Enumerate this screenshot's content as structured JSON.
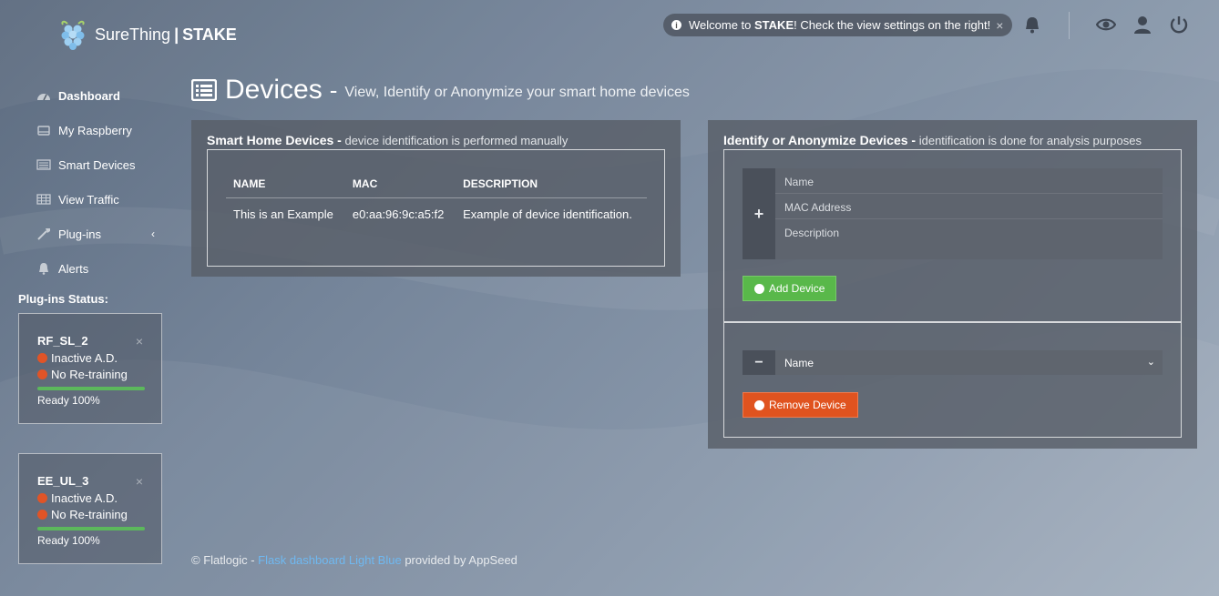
{
  "brand": {
    "name": "SureThing",
    "separator": "|",
    "product": "STAKE"
  },
  "welcome": {
    "prefix": "Welcome to ",
    "bold": "STAKE",
    "suffix": "! Check the view settings on the right!",
    "close": "×"
  },
  "header_icons": [
    "bell-icon",
    "eye-icon",
    "user-icon",
    "power-icon"
  ],
  "sidebar": {
    "items": [
      {
        "label": "Dashboard",
        "icon": "dashboard-icon",
        "active": true
      },
      {
        "label": "My Raspberry",
        "icon": "raspberry-icon"
      },
      {
        "label": "Smart Devices",
        "icon": "devices-list-icon"
      },
      {
        "label": "View Traffic",
        "icon": "table-icon"
      },
      {
        "label": "Plug-ins",
        "icon": "plugin-icon",
        "chevron": "‹"
      },
      {
        "label": "Alerts",
        "icon": "bell-icon"
      }
    ],
    "plugins_title": "Plug-ins Status:",
    "plugins": [
      {
        "name": "RF_SL_2",
        "status1": "Inactive A.D.",
        "status2": "No Re-training",
        "progress": 1.0,
        "ready": "Ready 100%"
      },
      {
        "name": "EE_UL_3",
        "status1": "Inactive A.D.",
        "status2": "No Re-training",
        "progress": 1.0,
        "ready": "Ready 100%"
      }
    ],
    "close": "×"
  },
  "page": {
    "title": "Devices",
    "dash": "-",
    "subtitle": "View, Identify or Anonymize your smart home devices"
  },
  "devices_panel": {
    "title": "Smart Home Devices -",
    "desc": "device identification is performed manually",
    "columns": [
      "NAME",
      "MAC",
      "DESCRIPTION"
    ],
    "rows": [
      [
        "This is an Example",
        "e0:aa:96:9c:a5:f2",
        "Example of device identification."
      ]
    ]
  },
  "identify_panel": {
    "title": "Identify or Anonymize Devices -",
    "desc": "identification is done for analysis purposes",
    "name_placeholder": "Name",
    "mac_placeholder": "MAC Address",
    "description_placeholder": "Description",
    "add_label": "Add Device",
    "select_value": "Name",
    "remove_label": "Remove Device",
    "plus": "+",
    "minus": "−"
  },
  "footer": {
    "prefix": "© Flatlogic - ",
    "link": "Flask dashboard Light Blue",
    "suffix": " provided by AppSeed"
  },
  "colors": {
    "accent_green": "#59b84a",
    "accent_red": "#e0531f",
    "status_dot": "#e05427",
    "link": "#6fb8f0"
  }
}
